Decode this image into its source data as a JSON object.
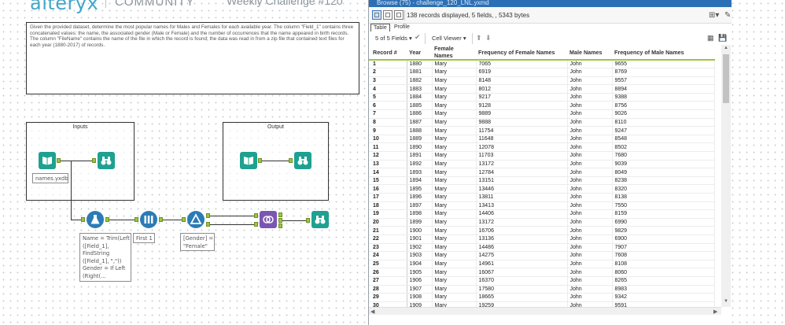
{
  "header": {
    "brand": "alteryx",
    "community": "COMMUNITY",
    "challenge_title": "Weekly Challenge #120"
  },
  "description": "Given the provided dataset, determine the most popular names for Males and Females for each available year.  The column \"Field_1\" contains three concatenated values: the name, the associated gender (Male or Female) and the number of occurrences that the name appeared in birth records.   The column \"FileName\" contains the name of the file in which the record is found; the data was read in from a zip file that contained text files for each year (1880-2017) of records.",
  "containers": {
    "inputs": "Inputs",
    "output": "Output"
  },
  "annotations": {
    "input_file": "names.yxdb",
    "formula": "Name = Trim(Left\n([Field_1],\nFindString\n([Field_1], \",\"))\nGender = If Left\n(Right(...",
    "sample": "First 1",
    "filter": "[Gender] =\n\"Female\""
  },
  "browse": {
    "title": "Browse (75) - challenge_120_LNL.yxmd",
    "records_info": "138 records displayed, 5 fields, , 5343 bytes",
    "tabs": [
      "Table",
      "Profile"
    ],
    "fields_select": "5 of 5 Fields",
    "viewer_select": "Cell Viewer",
    "columns": [
      "Record #",
      "Year",
      "Female Names",
      "Frequency of Female Names",
      "Male Names",
      "Frequency of Male Names"
    ],
    "rows": [
      [
        "1",
        "1880",
        "Mary",
        "7065",
        "John",
        "9655"
      ],
      [
        "2",
        "1881",
        "Mary",
        "6919",
        "John",
        "8769"
      ],
      [
        "3",
        "1882",
        "Mary",
        "8148",
        "John",
        "9557"
      ],
      [
        "4",
        "1883",
        "Mary",
        "8012",
        "John",
        "8894"
      ],
      [
        "5",
        "1884",
        "Mary",
        "9217",
        "John",
        "9388"
      ],
      [
        "6",
        "1885",
        "Mary",
        "9128",
        "John",
        "8756"
      ],
      [
        "7",
        "1886",
        "Mary",
        "9889",
        "John",
        "9026"
      ],
      [
        "8",
        "1887",
        "Mary",
        "9888",
        "John",
        "8110"
      ],
      [
        "9",
        "1888",
        "Mary",
        "11754",
        "John",
        "9247"
      ],
      [
        "10",
        "1889",
        "Mary",
        "11648",
        "John",
        "8548"
      ],
      [
        "11",
        "1890",
        "Mary",
        "12078",
        "John",
        "8502"
      ],
      [
        "12",
        "1891",
        "Mary",
        "11703",
        "John",
        "7680"
      ],
      [
        "13",
        "1892",
        "Mary",
        "13172",
        "John",
        "9039"
      ],
      [
        "14",
        "1893",
        "Mary",
        "12784",
        "John",
        "8049"
      ],
      [
        "15",
        "1894",
        "Mary",
        "13151",
        "John",
        "8238"
      ],
      [
        "16",
        "1895",
        "Mary",
        "13446",
        "John",
        "8320"
      ],
      [
        "17",
        "1896",
        "Mary",
        "13811",
        "John",
        "8138"
      ],
      [
        "18",
        "1897",
        "Mary",
        "13413",
        "John",
        "7550"
      ],
      [
        "19",
        "1898",
        "Mary",
        "14406",
        "John",
        "8159"
      ],
      [
        "20",
        "1899",
        "Mary",
        "13172",
        "John",
        "6990"
      ],
      [
        "21",
        "1900",
        "Mary",
        "16706",
        "John",
        "9829"
      ],
      [
        "22",
        "1901",
        "Mary",
        "13136",
        "John",
        "6900"
      ],
      [
        "23",
        "1902",
        "Mary",
        "14486",
        "John",
        "7907"
      ],
      [
        "24",
        "1903",
        "Mary",
        "14275",
        "John",
        "7608"
      ],
      [
        "25",
        "1904",
        "Mary",
        "14961",
        "John",
        "8108"
      ],
      [
        "26",
        "1905",
        "Mary",
        "16067",
        "John",
        "8060"
      ],
      [
        "27",
        "1906",
        "Mary",
        "16370",
        "John",
        "8265"
      ],
      [
        "28",
        "1907",
        "Mary",
        "17580",
        "John",
        "8983"
      ],
      [
        "29",
        "1908",
        "Mary",
        "18665",
        "John",
        "9342"
      ],
      [
        "30",
        "1909",
        "Mary",
        "19259",
        "John",
        "9591"
      ]
    ]
  },
  "icons": {
    "input_tool": "book-icon",
    "browse_tool": "binoculars-icon",
    "formula_tool": "flask-icon",
    "sample_tool": "sample-icon",
    "filter_tool": "filter-icon",
    "join_tool": "join-icon"
  },
  "colors": {
    "teal_tool": "#1ea191",
    "blue_tool": "#2b7bb6",
    "join_purple": "#7b55b3",
    "anchor_green": "#9ac73c",
    "title_bar": "#2b6fb6"
  }
}
